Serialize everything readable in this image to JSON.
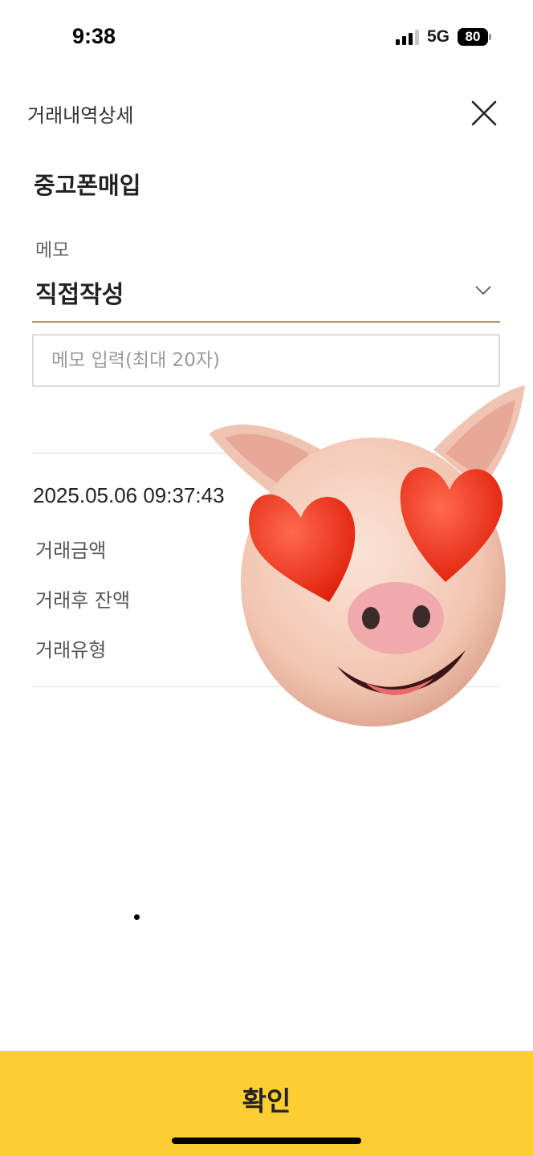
{
  "status_bar": {
    "time": "9:38",
    "network": "5G",
    "battery": "80"
  },
  "header": {
    "title": "거래내역상세",
    "close_icon": "close-icon"
  },
  "item": {
    "title": "중고폰매입"
  },
  "memo": {
    "label": "메모",
    "selected": "직접작성",
    "placeholder": "메모 입력(최대 20자)",
    "value": ""
  },
  "transaction": {
    "datetime": "2025.05.06 09:37:43",
    "rows": [
      {
        "label": "거래금액"
      },
      {
        "label": "거래후 잔액"
      },
      {
        "label": "거래유형"
      }
    ]
  },
  "footer": {
    "confirm_label": "확인",
    "color": "#fcce33"
  },
  "colors": {
    "accent_underline": "#b59a6a"
  },
  "overlay": {
    "sticker": "pig-heart-eyes-memoji"
  }
}
